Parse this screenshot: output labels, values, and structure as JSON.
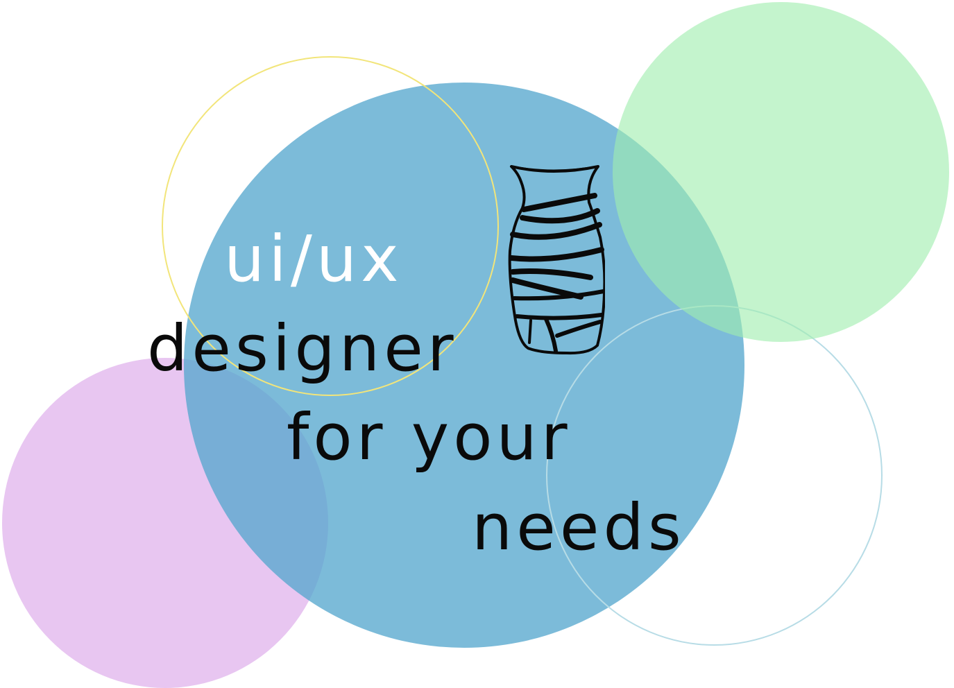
{
  "headline": {
    "line1": "ui/ux",
    "line2": "designer",
    "line3": "for your",
    "line4": "needs"
  },
  "colors": {
    "background": "#ffffff",
    "blue_circle": "#54a6cd",
    "green_circle": "#a0eeaf",
    "purple_circle": "#e8c6f1",
    "yellow_ring": "#f2e57a",
    "teal_ring": "#b7dce6",
    "headline_light": "#ffffff",
    "headline_dark": "#0a0a0a"
  },
  "icons": {
    "vase": "vase-icon"
  }
}
